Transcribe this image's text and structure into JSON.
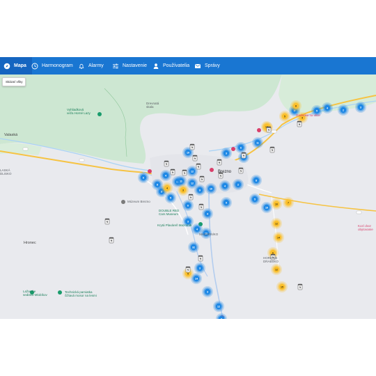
{
  "nav": {
    "items": [
      {
        "label": "Mapa",
        "icon": "compass-icon",
        "active": true
      },
      {
        "label": "Harmonogram",
        "icon": "clock-icon",
        "active": false
      },
      {
        "label": "Alarmy",
        "icon": "bell-icon",
        "active": false
      },
      {
        "label": "Nastavenie",
        "icon": "sliders-icon",
        "active": false
      },
      {
        "label": "Používatelia",
        "icon": "user-icon",
        "active": false
      },
      {
        "label": "Správy",
        "icon": "message-icon",
        "active": false
      }
    ]
  },
  "map": {
    "show_all_label": "Skázať všky",
    "labels": {
      "vyhliadkova": "Vyhliadková\nveža Horné Lazy",
      "drevnata": "Drevnatá\nskala",
      "valaska": "Valaská",
      "laska": "LASKÁ\nDLISKO",
      "brezno": "Brezno",
      "museum_brezno": "Múzeum Brezno",
      "double_red": "DOUBLE RED\nCars Museum",
      "kryta": "Krytá Plaváreň Mazorník",
      "mazorniko": "MAZORNÍKO",
      "hronec": "Hronec",
      "lazarske": "Lažarske\nsedisko-Mlobíkov",
      "technicka": "Technická pamiatka\nčižtavá mosor na lesmi",
      "kozi": "Kozí dvor\nobytovanie",
      "horenie": "HORENIE\nDRABSKO",
      "gaderika": "Gaderika sa ulice"
    },
    "clusters": [
      {
        "color": "blue",
        "count": "10"
      },
      {
        "color": "blue",
        "count": "3"
      },
      {
        "color": "blue",
        "count": "15"
      },
      {
        "color": "blue",
        "count": "12"
      },
      {
        "color": "blue",
        "count": "4"
      },
      {
        "color": "blue",
        "count": "19"
      },
      {
        "color": "blue",
        "count": "8"
      },
      {
        "color": "blue",
        "count": "6"
      },
      {
        "color": "blue",
        "count": "5"
      },
      {
        "color": "blue",
        "count": "12"
      },
      {
        "color": "blue",
        "count": "9"
      },
      {
        "color": "blue",
        "count": "10"
      },
      {
        "color": "blue",
        "count": "4"
      },
      {
        "color": "blue",
        "count": "2"
      },
      {
        "color": "blue",
        "count": "8"
      },
      {
        "color": "blue",
        "count": "5"
      },
      {
        "color": "blue",
        "count": "6"
      },
      {
        "color": "blue",
        "count": "11"
      },
      {
        "color": "blue",
        "count": "4"
      },
      {
        "color": "blue",
        "count": "9"
      },
      {
        "color": "blue",
        "count": "6"
      },
      {
        "color": "blue",
        "count": "3"
      },
      {
        "color": "blue",
        "count": "4"
      },
      {
        "color": "blue",
        "count": "16"
      },
      {
        "color": "blue",
        "count": "32"
      },
      {
        "color": "blue",
        "count": "3"
      },
      {
        "color": "blue",
        "count": "14"
      },
      {
        "color": "blue",
        "count": "3"
      },
      {
        "color": "blue",
        "count": "12"
      },
      {
        "color": "blue",
        "count": "8"
      },
      {
        "color": "blue",
        "count": "11"
      },
      {
        "color": "blue",
        "count": "3"
      },
      {
        "color": "blue",
        "count": "10"
      },
      {
        "color": "blue",
        "count": "7"
      },
      {
        "color": "blue",
        "count": "4"
      },
      {
        "color": "blue",
        "count": "2"
      },
      {
        "color": "blue",
        "count": "3"
      },
      {
        "color": "blue",
        "count": "5"
      },
      {
        "color": "yellow",
        "count": "8"
      },
      {
        "color": "yellow",
        "count": "5"
      },
      {
        "color": "yellow",
        "count": "4"
      },
      {
        "color": "yellow",
        "count": "7"
      },
      {
        "color": "yellow",
        "count": "10"
      },
      {
        "color": "yellow",
        "count": "12"
      },
      {
        "color": "yellow",
        "count": "14"
      },
      {
        "color": "yellow",
        "count": "6"
      },
      {
        "color": "yellow",
        "count": "12"
      },
      {
        "color": "yellow",
        "count": "15"
      },
      {
        "color": "yellow",
        "count": "14"
      },
      {
        "color": "yellow",
        "count": "4"
      },
      {
        "color": "yellow",
        "count": "3"
      },
      {
        "color": "yellow",
        "count": "5"
      },
      {
        "color": "yellow",
        "count": "7"
      }
    ],
    "colors": {
      "blue": "#1e88e5",
      "yellow": "#fbc02d",
      "nav": "#1976d2",
      "forest": "#cfe8d3",
      "road": "#f6c343"
    }
  }
}
